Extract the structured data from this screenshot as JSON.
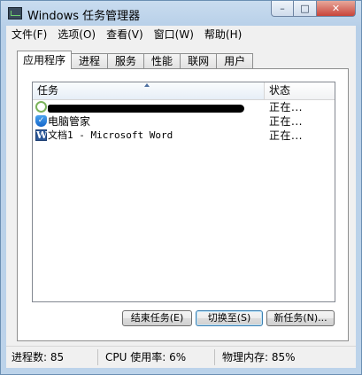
{
  "window": {
    "title": "Windows 任务管理器",
    "minimize_glyph": "–",
    "maximize_glyph": "□",
    "close_glyph": "✕"
  },
  "menu": {
    "items": [
      {
        "label": "文件(F)"
      },
      {
        "label": "选项(O)"
      },
      {
        "label": "查看(V)"
      },
      {
        "label": "窗口(W)"
      },
      {
        "label": "帮助(H)"
      }
    ]
  },
  "tabs": [
    {
      "label": "应用程序",
      "active": true
    },
    {
      "label": "进程",
      "active": false
    },
    {
      "label": "服务",
      "active": false
    },
    {
      "label": "性能",
      "active": false
    },
    {
      "label": "联网",
      "active": false
    },
    {
      "label": "用户",
      "active": false
    }
  ],
  "table": {
    "columns": {
      "task": "任务",
      "status": "状态"
    },
    "rows": [
      {
        "name": "",
        "status": "正在...",
        "icon": "round-app-icon",
        "name_redacted": true
      },
      {
        "name": "电脑管家",
        "status": "正在...",
        "icon": "shield-icon"
      },
      {
        "name": "文档1 - Microsoft Word",
        "status": "正在...",
        "icon": "word-icon"
      }
    ]
  },
  "icons": {
    "shield_glyph": "✓",
    "word_glyph": "W"
  },
  "buttons": {
    "end_task": "结束任务(E)",
    "switch_to": "切换至(S)",
    "new_task": "新任务(N)..."
  },
  "statusbar": {
    "processes": "进程数: 85",
    "cpu": "CPU 使用率: 6%",
    "memory": "物理内存: 85%"
  },
  "colors": {
    "frame": "#b7cfe8",
    "close_button": "#c7443a",
    "word_icon": "#2b5797",
    "shield_icon": "#1565c8"
  }
}
